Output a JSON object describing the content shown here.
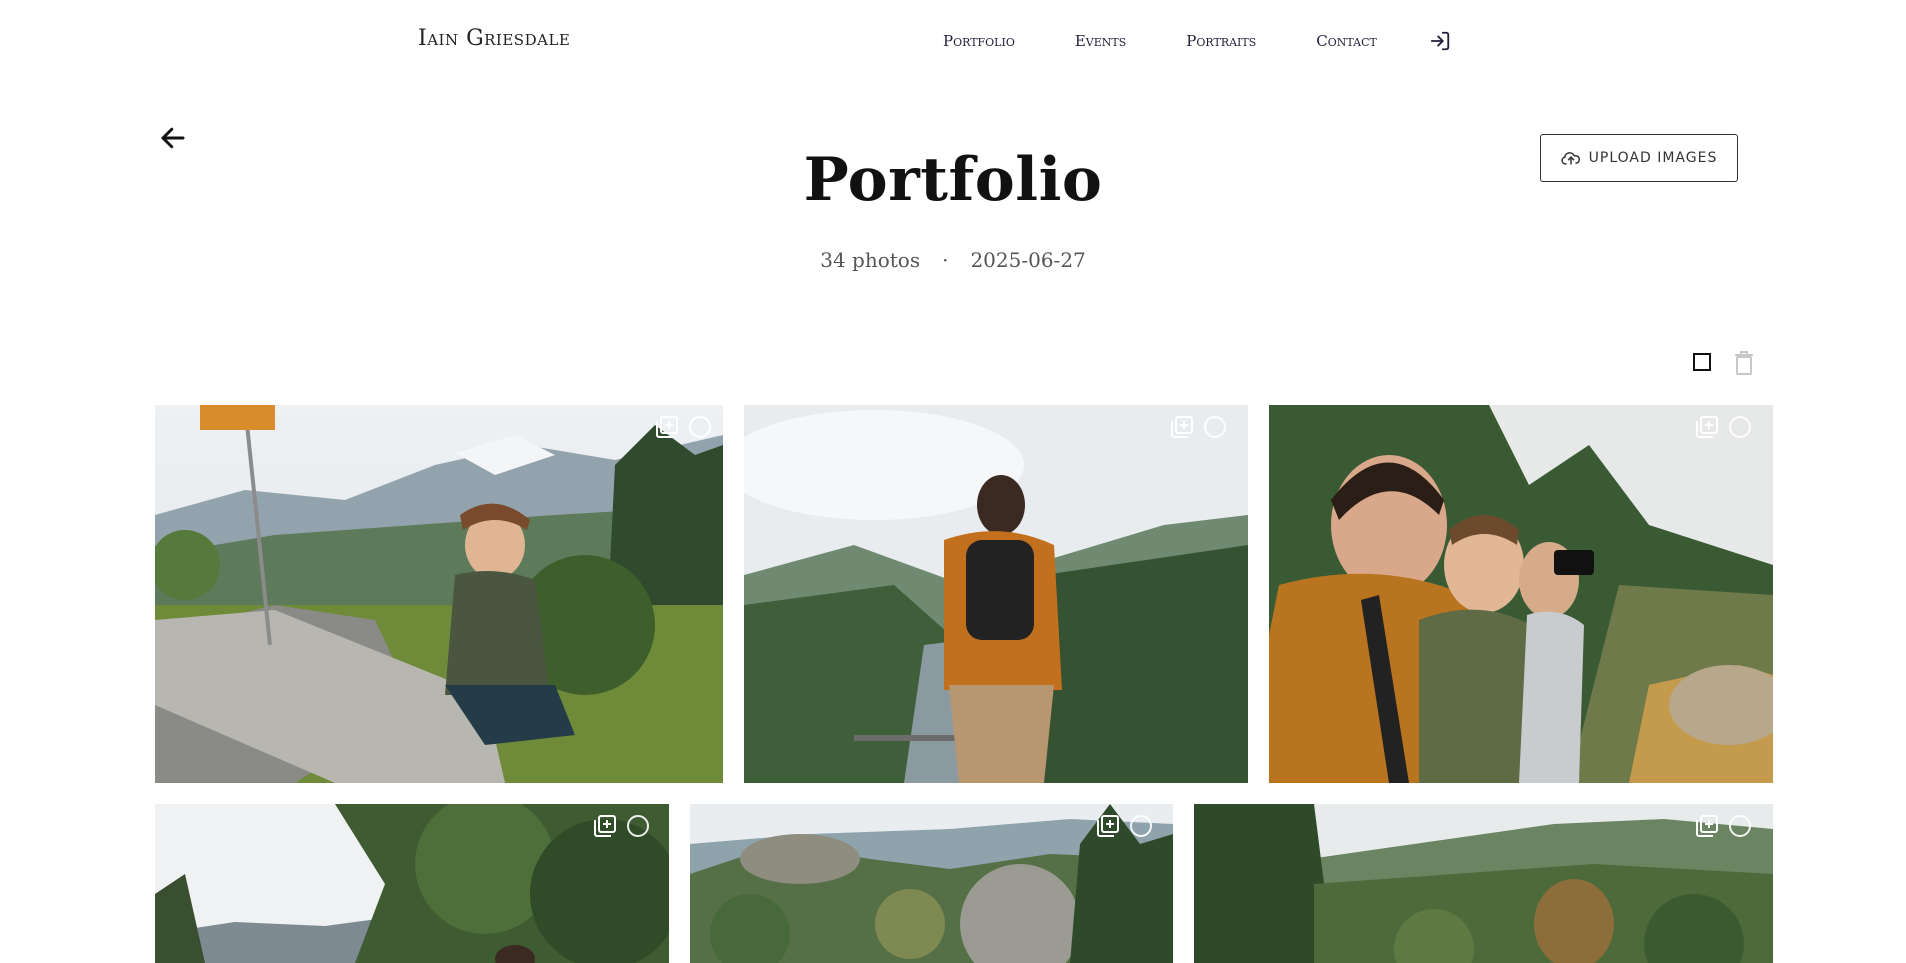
{
  "header": {
    "brand": "Iain Griesdale",
    "nav": [
      {
        "label": "Portfolio"
      },
      {
        "label": "Events"
      },
      {
        "label": "Portraits"
      },
      {
        "label": "Contact"
      }
    ]
  },
  "page": {
    "title": "Portfolio",
    "photo_count": "34 photos",
    "separator": "·",
    "date": "2025-06-27"
  },
  "actions": {
    "upload_label": "UPLOAD IMAGES"
  },
  "icons": {
    "back": "arrow-left-icon",
    "login": "login-icon",
    "upload": "cloud-upload-icon",
    "select_all": "square-icon",
    "delete": "trash-icon",
    "add_to_collection": "add-to-collection-icon",
    "select": "select-circle-icon"
  },
  "colors": {
    "nav_text": "#1f1f3a",
    "meta_text": "#555555",
    "border": "#333333"
  }
}
